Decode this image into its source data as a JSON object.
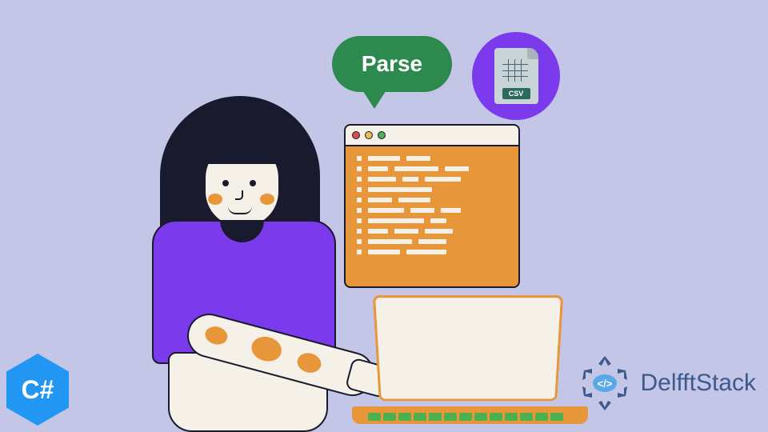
{
  "bubble": {
    "text": "Parse"
  },
  "csv": {
    "label": "CSV"
  },
  "csharp": {
    "label": "C#"
  },
  "brand": {
    "name": "DelfftStack"
  },
  "code_lines": [
    [
      40,
      30
    ],
    [
      25,
      55,
      30
    ],
    [
      35,
      20,
      45
    ],
    [
      80
    ],
    [
      30,
      40
    ],
    [
      45,
      30,
      25
    ],
    [
      70,
      20
    ],
    [
      25,
      30,
      35
    ],
    [
      55,
      35
    ],
    [
      40,
      50
    ]
  ]
}
